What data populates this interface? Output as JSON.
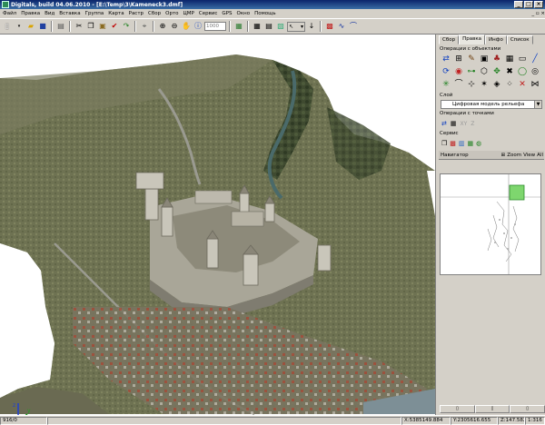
{
  "window": {
    "title": "Digitals, build 04.06.2010 - [E:\\Temp\\3\\Kameneck3.dmf]",
    "minimize": "_",
    "maximize": "□",
    "close": "×"
  },
  "menu": [
    "Файл",
    "Правка",
    "Вид",
    "Вставка",
    "Группа",
    "Карта",
    "Растр",
    "Сбор",
    "Орто",
    "ЦМР",
    "Сервис",
    "GPS",
    "Окно",
    "Помощь"
  ],
  "toolbar": {
    "scale_placeholder": "1000",
    "buttons": [
      "new-icon",
      "open-icon",
      "save-icon",
      "print-icon",
      "cut-icon",
      "copy-icon",
      "paste-icon",
      "check-icon",
      "redo-icon",
      "select-icon",
      "zoom-in-icon",
      "zoom-out-icon",
      "pan-icon",
      "info-icon",
      "layers-icon",
      "grid-icon",
      "table-icon",
      "dem-icon"
    ]
  },
  "panel": {
    "tabs": [
      "Сбор",
      "Правка",
      "Инфо",
      "Список"
    ],
    "active_tab": "Правка",
    "section_objects": "Операции с объектами",
    "section_layer": "Слой",
    "layer_value": "Цифровая модель рельефа",
    "section_points": "Операции с точками",
    "point_labels": {
      "xy": "XY",
      "z": "Z"
    },
    "section_service": "Сервис",
    "navigator": {
      "title": "Навигатор",
      "zoom": "Zoom",
      "view": "View",
      "all": "All"
    }
  },
  "statusbar": {
    "scale": "916/0",
    "x": "X:5385149.884",
    "y": "Y:2305616.655",
    "z": "Z:147.582",
    "ratio": "1:316"
  },
  "colors": {
    "accent": "#0a246a",
    "panel": "#d4d0c8"
  }
}
